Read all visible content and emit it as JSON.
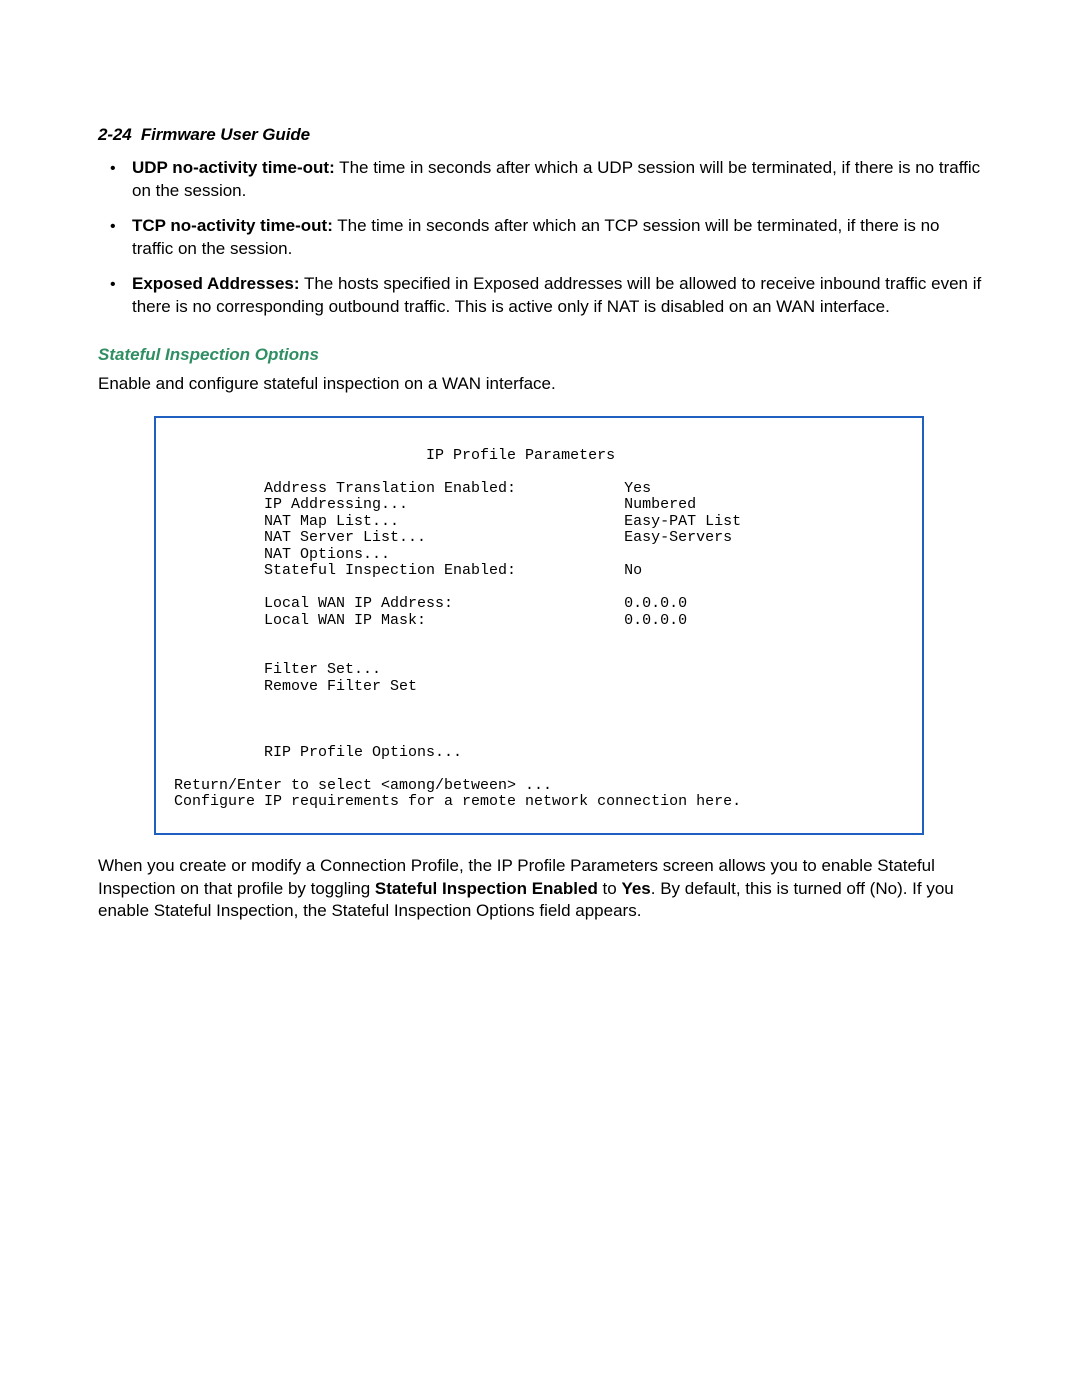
{
  "header": {
    "page_number": "2-24",
    "title": "Firmware User Guide"
  },
  "bullets": [
    {
      "term": "UDP no-activity time-out:",
      "text": " The time in seconds after which a UDP session will be terminated, if there is no traffic on the session."
    },
    {
      "term": "TCP no-activity time-out:",
      "text": " The time in seconds after which an TCP session will be terminated, if there is no traffic on the session."
    },
    {
      "term": "Exposed Addresses:",
      "text": " The hosts specified in Exposed addresses will be allowed to receive inbound traffic even if there is no corresponding outbound traffic. This is active only if NAT is disabled on an WAN interface."
    }
  ],
  "section_heading": "Stateful Inspection Options",
  "section_intro": "Enable and configure stateful inspection on a WAN interface.",
  "terminal": {
    "title": "IP Profile Parameters",
    "rows": [
      {
        "label": "Address Translation Enabled:",
        "value": "Yes"
      },
      {
        "label": "IP Addressing...",
        "value": "Numbered"
      },
      {
        "label": "NAT Map List...",
        "value": "Easy-PAT List"
      },
      {
        "label": "NAT Server List...",
        "value": "Easy-Servers"
      },
      {
        "label": "NAT Options...",
        "value": ""
      },
      {
        "label": "Stateful Inspection Enabled:",
        "value": "No"
      }
    ],
    "rows2": [
      {
        "label": "Local WAN IP Address:",
        "value": "0.0.0.0"
      },
      {
        "label": "Local WAN IP Mask:",
        "value": "0.0.0.0"
      }
    ],
    "filter_label": "Filter Set...",
    "remove_filter_label": "Remove Filter Set",
    "rip_label": "RIP Profile Options...",
    "footer1": "Return/Enter to select <among/between> ...",
    "footer2": "Configure IP requirements for a remote network connection here."
  },
  "closing": {
    "pre": "When you create or modify a Connection Profile, the IP Profile Parameters screen allows you to enable Stateful Inspection on that profile by toggling ",
    "bold1": "Stateful Inspection Enabled",
    "mid": " to ",
    "bold2": "Yes",
    "post": ". By default, this is turned off (No). If you enable Stateful Inspection, the Stateful Inspection Options field appears."
  }
}
